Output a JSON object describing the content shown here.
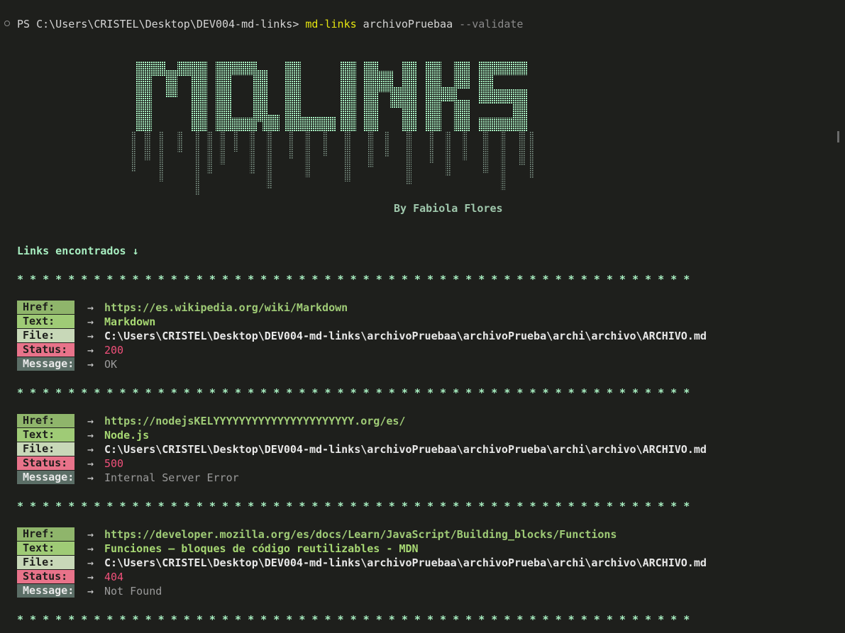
{
  "terminal": {
    "prompt_prefix": "PS C:\\Users\\CRISTEL\\Desktop\\DEV004-md-links> ",
    "command": "md-links",
    "argument": " archivoPruebaa",
    "flag": " --validate"
  },
  "banner": {
    "logo_text": "MD.LINKS",
    "byline": "By Fabiola Flores",
    "colors": {
      "logo": "#a8efc1",
      "drip": "#8aa395"
    }
  },
  "results": {
    "header": "Links encontrados ↓",
    "separator": "* * * * * * * * * * * * * * * * * * * * * * * * * * * * * * * * * * * * * * * * * * * * * * * * * * * * *",
    "labels": {
      "href": "Href:",
      "text": "Text:",
      "file": "File:",
      "status": "Status:",
      "message": "Message:"
    },
    "arrow": "→",
    "links": [
      {
        "href": "https://es.wikipedia.org/wiki/Markdown",
        "text": "Markdown",
        "file": "C:\\Users\\CRISTEL\\Desktop\\DEV004-md-links\\archivoPruebaa\\archivoPrueba\\archi\\archivo\\ARCHIVO.md",
        "status": "200",
        "message": "OK"
      },
      {
        "href": "https://nodejsKELYYYYYYYYYYYYYYYYYYYYYY.org/es/",
        "text": "Node.js",
        "file": "C:\\Users\\CRISTEL\\Desktop\\DEV004-md-links\\archivoPruebaa\\archivoPrueba\\archi\\archivo\\ARCHIVO.md",
        "status": "500",
        "message": "Internal Server Error"
      },
      {
        "href": "https://developer.mozilla.org/es/docs/Learn/JavaScript/Building_blocks/Functions",
        "text": "Funciones — bloques de código reutilizables - MDN",
        "file": "C:\\Users\\CRISTEL\\Desktop\\DEV004-md-links\\archivoPruebaa\\archivoPrueba\\archi\\archivo\\ARCHIVO.md",
        "status": "404",
        "message": "Not Found"
      }
    ]
  }
}
